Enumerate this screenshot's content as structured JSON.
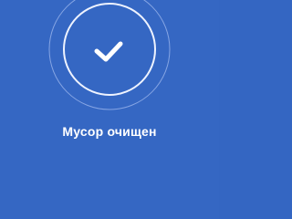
{
  "screen": {
    "icon": "checkmark-icon",
    "status_text": "Мусор очищен"
  },
  "colors": {
    "background": "#3567c3",
    "ring": "#dbe6ff",
    "check": "#ffffff"
  }
}
